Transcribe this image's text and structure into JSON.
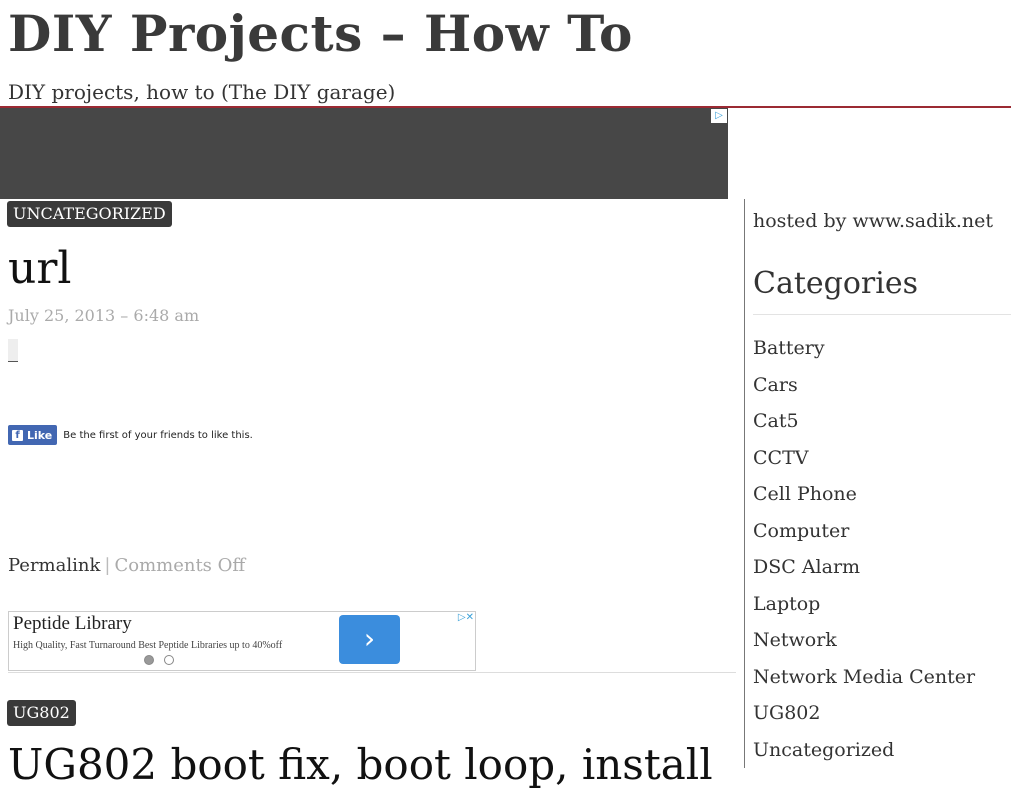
{
  "site": {
    "title": "DIY Projects – How To",
    "tagline": "DIY projects, how to (The DIY garage)"
  },
  "ad_banner": {
    "choice_icon": "ad-choices-icon"
  },
  "post1": {
    "category": "UNCATEGORIZED",
    "title": "url",
    "date": "July 25, 2013 – 6:48 am",
    "fb": {
      "icon": "f",
      "like_label": "Like",
      "text": "Be the first of your friends to like this."
    },
    "permalink": "Permalink",
    "separator": "|",
    "comments": "Comments Off"
  },
  "ad_small": {
    "title": "Peptide Library",
    "description": "High Quality, Fast Turnaround Best Peptide Libraries up to 40%off",
    "arrow": "›"
  },
  "post2": {
    "category": "UG802",
    "title": "UG802 boot fix, boot loop, install"
  },
  "sidebar": {
    "hosted_text": "hosted by www.sadik.net",
    "categories_title": "Categories",
    "categories": [
      "Battery",
      "Cars",
      "Cat5",
      "CCTV",
      "Cell Phone",
      "Computer",
      "DSC Alarm",
      "Laptop",
      "Network",
      "Network Media Center",
      "UG802",
      "Uncategorized"
    ]
  },
  "colors": {
    "header_rule": "#9b2a33",
    "badge_bg": "#3a3a3a",
    "fb_blue": "#4267b2",
    "ad_button": "#3b8ddd"
  }
}
